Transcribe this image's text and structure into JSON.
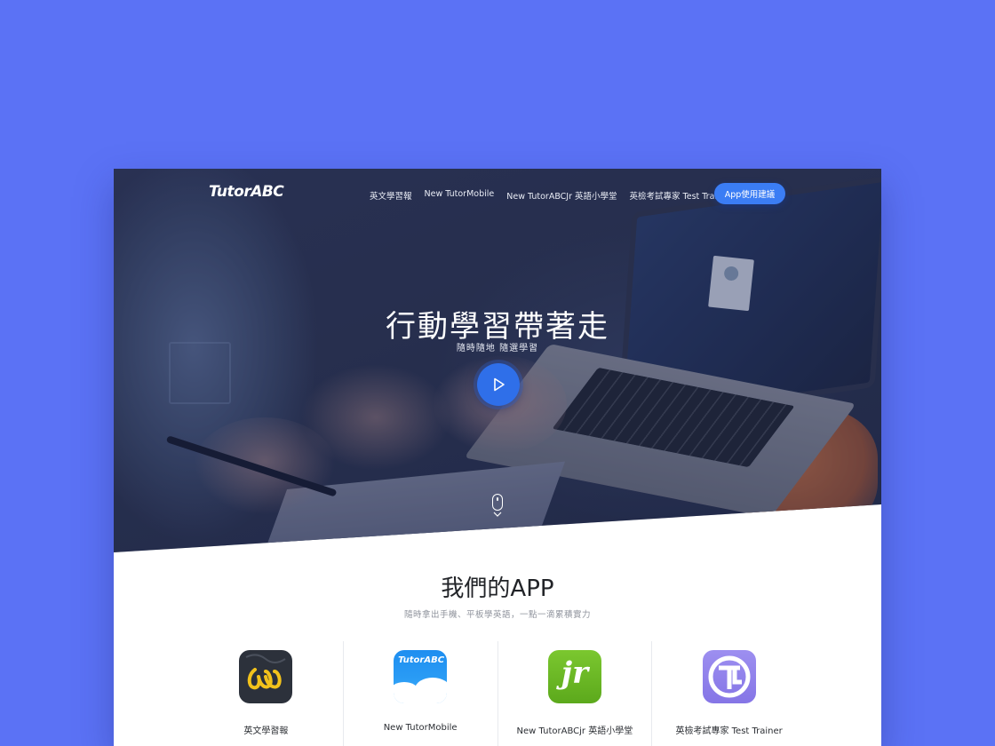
{
  "brand": {
    "logo_text": "TutorABC"
  },
  "nav": {
    "links": [
      {
        "label": "英文學習報"
      },
      {
        "label": "New TutorMobile"
      },
      {
        "label": "New TutorABCJr 英語小學堂"
      },
      {
        "label": "英檢考試專家 Test Trainer"
      }
    ],
    "cta_label": "App使用建議"
  },
  "hero": {
    "title": "行動學習帶著走",
    "subtitle": "隨時隨地 隨選學習",
    "play_icon": "play-icon",
    "scroll_icon": "mouse-scroll-icon"
  },
  "apps_section": {
    "title": "我們的APP",
    "subtitle": "隨時拿出手機、平板學英語，一點一滴累積實力",
    "apps": [
      {
        "label": "英文學習報",
        "icon": "english-news-app-icon",
        "icon_text": "ll"
      },
      {
        "label": "New TutorMobile",
        "icon": "tutormobile-app-icon",
        "icon_text": "TutorABC"
      },
      {
        "label": "New TutorABCjr 英語小學堂",
        "icon": "tutorabcjr-app-icon",
        "icon_text": "jr"
      },
      {
        "label": "英檢考試專家 Test Trainer",
        "icon": "test-trainer-app-icon",
        "icon_text": ""
      }
    ]
  },
  "colors": {
    "background": "#5b72f5",
    "accent": "#3b7df4",
    "jr_green": "#6cb826",
    "trainer_purple": "#8f80ea"
  }
}
